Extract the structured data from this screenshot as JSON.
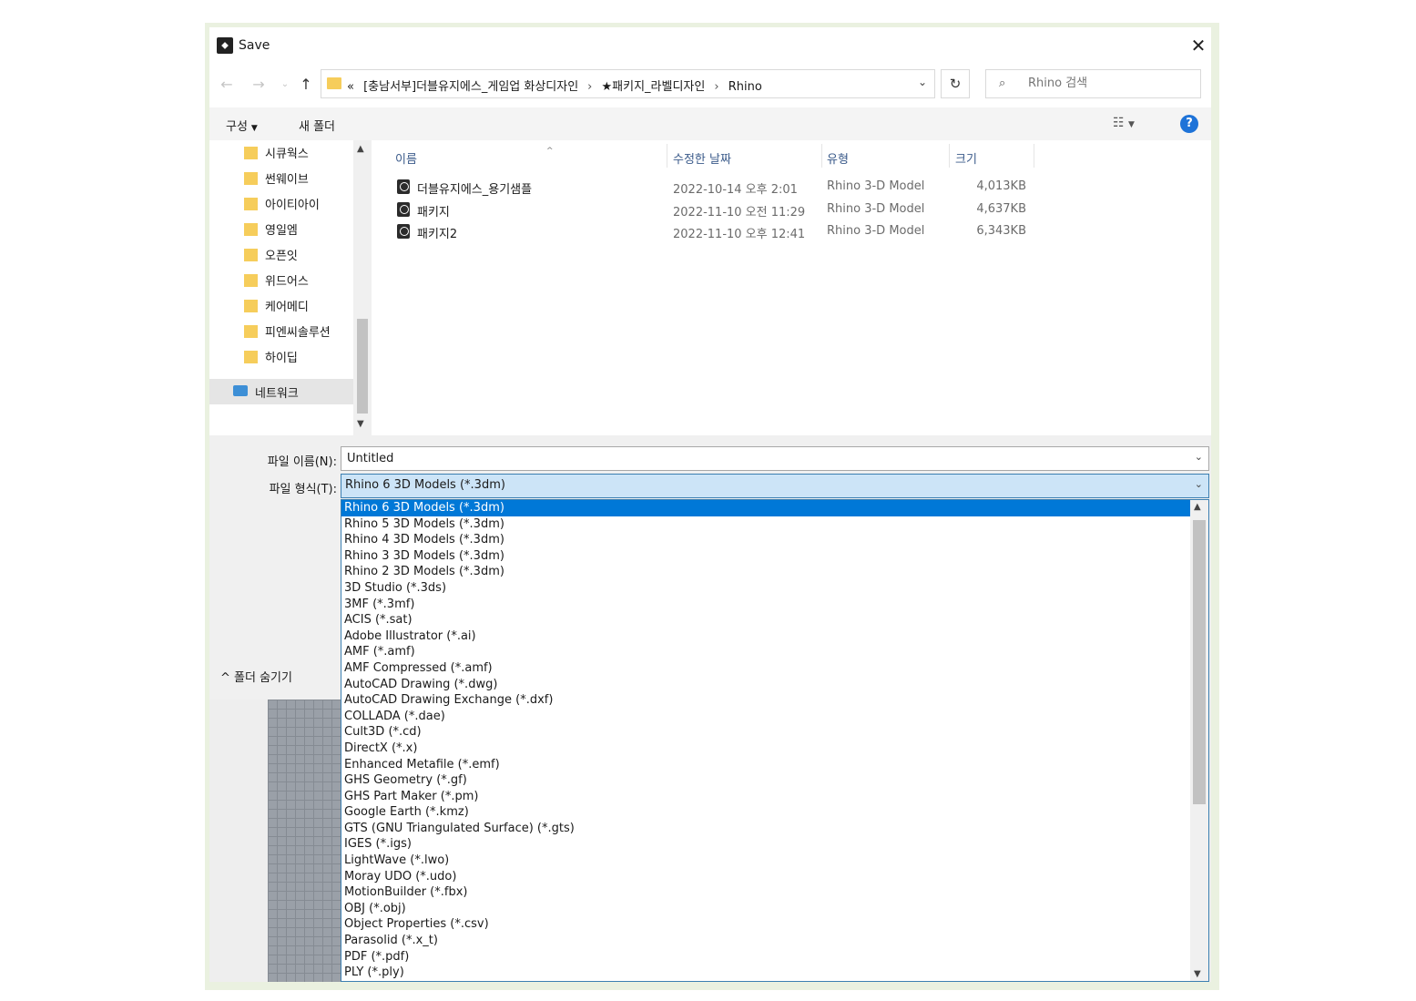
{
  "window": {
    "title": "Save"
  },
  "nav": {
    "back_icon": "arrow-left-icon",
    "forward_icon": "arrow-right-icon",
    "recent_icon": "chevron-down-icon",
    "up_icon": "arrow-up-icon"
  },
  "address": {
    "prefix": "«",
    "crumbs": [
      "[충남서부]더블유지에스_게임업 화상디자인",
      "★패키지_라벨디자인",
      "Rhino"
    ]
  },
  "search": {
    "placeholder": "Rhino 검색"
  },
  "toolbar": {
    "organize": "구성",
    "new_folder": "새 폴더"
  },
  "sidebar": {
    "items": [
      "시큐웍스",
      "썬웨이브",
      "아이티아이",
      "영일엠",
      "오픈잇",
      "위드어스",
      "케어메디",
      "피엔씨솔루션",
      "하이딥"
    ],
    "network": "네트워크"
  },
  "files": {
    "columns": {
      "name": "이름",
      "date": "수정한 날짜",
      "type": "유형",
      "size": "크기"
    },
    "rows": [
      {
        "name": "더블유지에스_용기샘플",
        "date": "2022-10-14 오후 2:01",
        "type": "Rhino 3-D Model",
        "size": "4,013KB"
      },
      {
        "name": "패키지",
        "date": "2022-11-10 오전 11:29",
        "type": "Rhino 3-D Model",
        "size": "4,637KB"
      },
      {
        "name": "패키지2",
        "date": "2022-11-10 오후 12:41",
        "type": "Rhino 3-D Model",
        "size": "6,343KB"
      }
    ]
  },
  "form": {
    "filename_label": "파일 이름(N):",
    "filename_value": "Untitled",
    "filetype_label": "파일 형식(T):",
    "filetype_value": "Rhino 6 3D Models (*.3dm)",
    "hide_folders": "폴더 숨기기"
  },
  "filetype_options": [
    "Rhino 6 3D Models (*.3dm)",
    "Rhino 5 3D Models (*.3dm)",
    "Rhino 4 3D Models (*.3dm)",
    "Rhino 3 3D Models (*.3dm)",
    "Rhino 2 3D Models (*.3dm)",
    "3D Studio (*.3ds)",
    "3MF (*.3mf)",
    "ACIS (*.sat)",
    "Adobe Illustrator (*.ai)",
    "AMF (*.amf)",
    "AMF Compressed (*.amf)",
    "AutoCAD Drawing (*.dwg)",
    "AutoCAD Drawing Exchange (*.dxf)",
    "COLLADA (*.dae)",
    "Cult3D (*.cd)",
    "DirectX (*.x)",
    "Enhanced Metafile (*.emf)",
    "GHS Geometry (*.gf)",
    "GHS Part Maker (*.pm)",
    "Google Earth (*.kmz)",
    "GTS (GNU Triangulated Surface) (*.gts)",
    "IGES (*.igs)",
    "LightWave (*.lwo)",
    "Moray UDO (*.udo)",
    "MotionBuilder (*.fbx)",
    "OBJ (*.obj)",
    "Object Properties (*.csv)",
    "Parasolid (*.x_t)",
    "PDF (*.pdf)",
    "PLY (*.ply)"
  ],
  "colors": {
    "accent": "#0078d7",
    "folder": "#f6cd5b",
    "selected_field": "#cce4f7"
  }
}
